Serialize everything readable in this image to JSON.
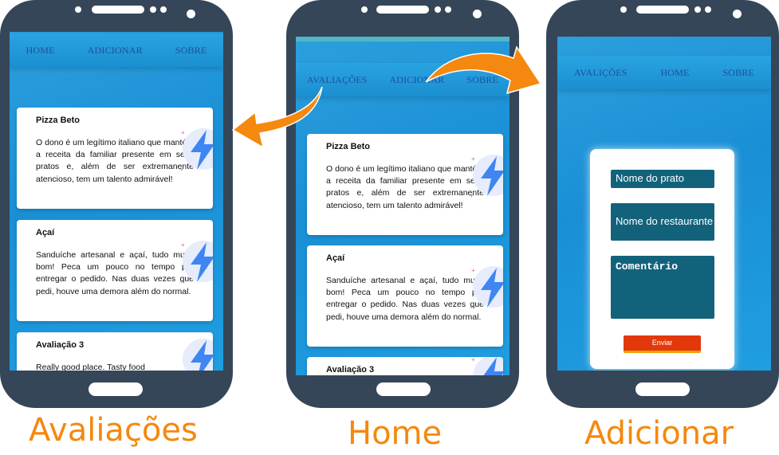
{
  "screens": {
    "avaliacoes": {
      "caption": "Avaliações",
      "nav": [
        "HOME",
        "ADICIONAR",
        "SOBRE"
      ],
      "cards": [
        {
          "title": "Pizza Beto",
          "text": "O dono é um legítimo italiano que mantém a receita da familiar presente em seus pratos e, além de ser extremanente atencioso, tem um talento admirável!"
        },
        {
          "title": "Açaí",
          "text": "Sanduíche artesanal e açaí, tudo muito bom! Peca um pouco no tempo pra entregar o pedido. Nas duas vezes que pedi, houve uma demora além do normal."
        },
        {
          "title": "Avaliação 3",
          "text": "Really good place. Tasty food"
        }
      ]
    },
    "home": {
      "caption": "Home",
      "nav": [
        "AVALIAÇÕES",
        "ADICIONAR",
        "SOBRE"
      ],
      "cards": [
        {
          "title": "Pizza Beto",
          "text": "O dono é um legítimo italiano que mantém a receita da familiar presente em seus pratos e, além de ser extremanente atencioso, tem um talento admirável!"
        },
        {
          "title": "Açaí",
          "text": "Sanduíche artesanal e açaí, tudo muito bom! Peca um pouco no tempo pra entregar o pedido. Nas duas vezes que pedi, houve uma demora além do normal."
        },
        {
          "title": "Avaliação 3"
        }
      ]
    },
    "adicionar": {
      "caption": "Adicionar",
      "nav": [
        "AVALIÇÕES",
        "HOME",
        "SOBRE"
      ],
      "form": {
        "dish_placeholder": "Nome do prato",
        "restaurant_placeholder": "Nome do restaurante",
        "comment_placeholder": "Comentário",
        "submit_label": "Enviar"
      }
    }
  },
  "colors": {
    "phone_body": "#354659",
    "screen_blue": "#1a8fd6",
    "field_teal": "#13627c",
    "submit_red": "#e2380c",
    "arrow_orange": "#f5880e"
  },
  "icons": [
    "lightning-icon",
    "curved-arrow-icon"
  ]
}
